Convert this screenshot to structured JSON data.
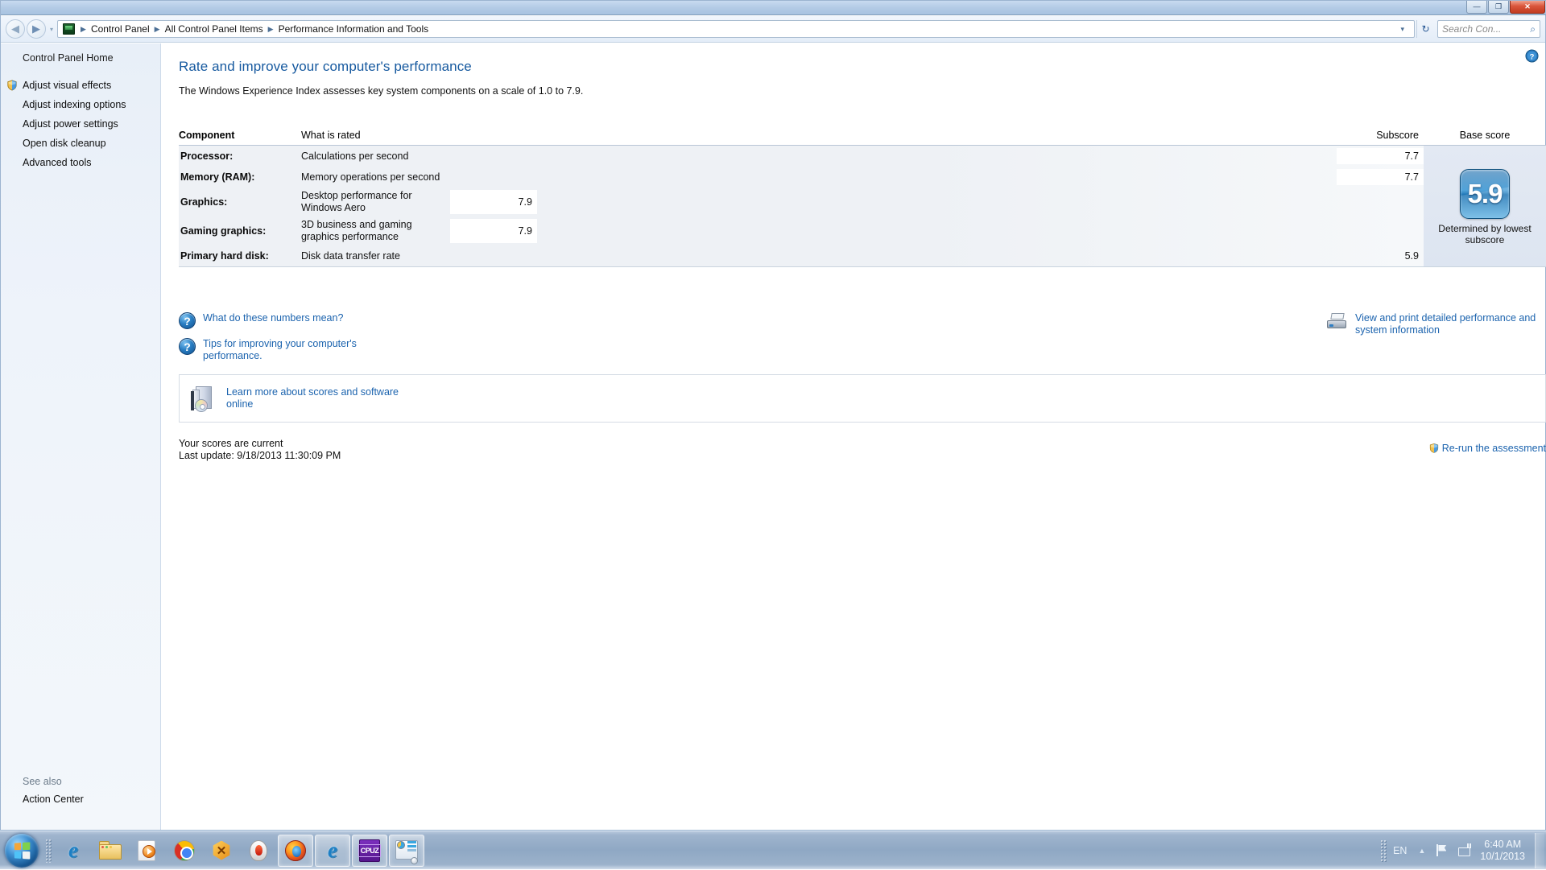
{
  "window": {
    "controls": {
      "minimize": "—",
      "restore": "❐",
      "close": "✕"
    }
  },
  "addressbar": {
    "back_icon": "◀",
    "forward_icon": "▶",
    "history_chevron": "▾",
    "breadcrumbs": [
      "Control Panel",
      "All Control Panel Items",
      "Performance Information and Tools"
    ],
    "separator": "▶",
    "dropdown_chevron": "▾",
    "refresh_icon": "↻",
    "search": {
      "placeholder": "Search Con...",
      "value": "",
      "icon": "⌕"
    }
  },
  "sidebar": {
    "home_label": "Control Panel Home",
    "items": [
      {
        "label": "Adjust visual effects",
        "shield": true
      },
      {
        "label": "Adjust indexing options",
        "shield": false
      },
      {
        "label": "Adjust power settings",
        "shield": false
      },
      {
        "label": "Open disk cleanup",
        "shield": false
      },
      {
        "label": "Advanced tools",
        "shield": false
      }
    ],
    "see_also_title": "See also",
    "see_also_items": [
      {
        "label": "Action Center"
      }
    ]
  },
  "content": {
    "help_icon": "?",
    "page_title": "Rate and improve your computer's performance",
    "subtitle": "The Windows Experience Index assesses key system components on a scale of 1.0 to 7.9.",
    "table": {
      "headers": {
        "component": "Component",
        "what_is_rated": "What is rated",
        "subscore": "Subscore",
        "base_score": "Base score"
      },
      "rows": [
        {
          "component": "Processor:",
          "rated": "Calculations per second",
          "subscore": "7.7"
        },
        {
          "component": "Memory (RAM):",
          "rated": "Memory operations per second",
          "subscore": "7.7"
        },
        {
          "component": "Graphics:",
          "rated": "Desktop performance for Windows Aero",
          "subscore": "7.9"
        },
        {
          "component": "Gaming graphics:",
          "rated": "3D business and gaming graphics performance",
          "subscore": "7.9"
        },
        {
          "component": "Primary hard disk:",
          "rated": "Disk data transfer rate",
          "subscore": "5.9"
        }
      ],
      "base_score_value": "5.9",
      "base_score_caption": "Determined by lowest subscore"
    },
    "links": {
      "what_do_numbers_mean": "What do these numbers mean?",
      "tips_for_improving": "Tips for improving your computer's performance.",
      "view_and_print": "View and print detailed performance and system information",
      "learn_more": "Learn more about scores and software online",
      "question_glyph": "?"
    },
    "footer": {
      "status": "Your scores are current",
      "last_update": "Last update: 9/18/2013 11:30:09 PM",
      "rerun_label": "Re-run the assessment"
    }
  },
  "taskbar": {
    "start_label": "Start",
    "items": [
      {
        "name": "internet-explorer",
        "running": false
      },
      {
        "name": "windows-explorer",
        "running": false
      },
      {
        "name": "windows-media-player",
        "running": false
      },
      {
        "name": "google-chrome",
        "running": false
      },
      {
        "name": "xtool",
        "running": false
      },
      {
        "name": "nero",
        "running": false
      },
      {
        "name": "firefox",
        "running": true
      },
      {
        "name": "internet-explorer-window",
        "running": true
      },
      {
        "name": "cpu-z",
        "running": true
      },
      {
        "name": "system-monitor",
        "running": true
      }
    ],
    "tray": {
      "language": "EN",
      "arrow": "▲",
      "time": "6:40 AM",
      "date": "10/1/2013"
    }
  },
  "colors": {
    "accent_link": "#1b63ae",
    "title_blue": "#16599f",
    "badge_blue": "#2f8fd0",
    "close_red": "#c03b20",
    "table_row_bg": "#eef1f5"
  }
}
